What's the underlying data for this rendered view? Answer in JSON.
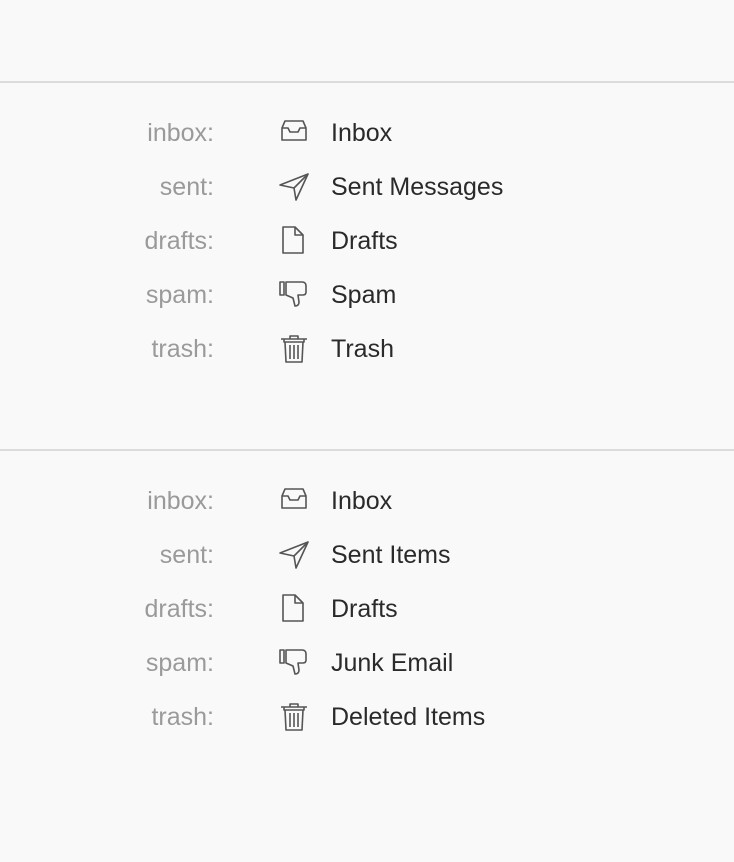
{
  "sections": [
    {
      "rows": [
        {
          "key": "inbox:",
          "icon": "inbox-tray-icon",
          "label": "Inbox"
        },
        {
          "key": "sent:",
          "icon": "paper-plane-icon",
          "label": "Sent Messages"
        },
        {
          "key": "drafts:",
          "icon": "document-icon",
          "label": "Drafts"
        },
        {
          "key": "spam:",
          "icon": "thumbs-down-icon",
          "label": "Spam"
        },
        {
          "key": "trash:",
          "icon": "trash-can-icon",
          "label": "Trash"
        }
      ]
    },
    {
      "rows": [
        {
          "key": "inbox:",
          "icon": "inbox-tray-icon",
          "label": "Inbox"
        },
        {
          "key": "sent:",
          "icon": "paper-plane-icon",
          "label": "Sent Items"
        },
        {
          "key": "drafts:",
          "icon": "document-icon",
          "label": "Drafts"
        },
        {
          "key": "spam:",
          "icon": "thumbs-down-icon",
          "label": "Junk Email"
        },
        {
          "key": "trash:",
          "icon": "trash-can-icon",
          "label": "Deleted Items"
        }
      ]
    }
  ],
  "colors": {
    "background": "#f9f9f9",
    "divider": "#dcdcdc",
    "key_text": "#9a9a9a",
    "label_text": "#2a2a2a",
    "icon_stroke": "#555555"
  }
}
